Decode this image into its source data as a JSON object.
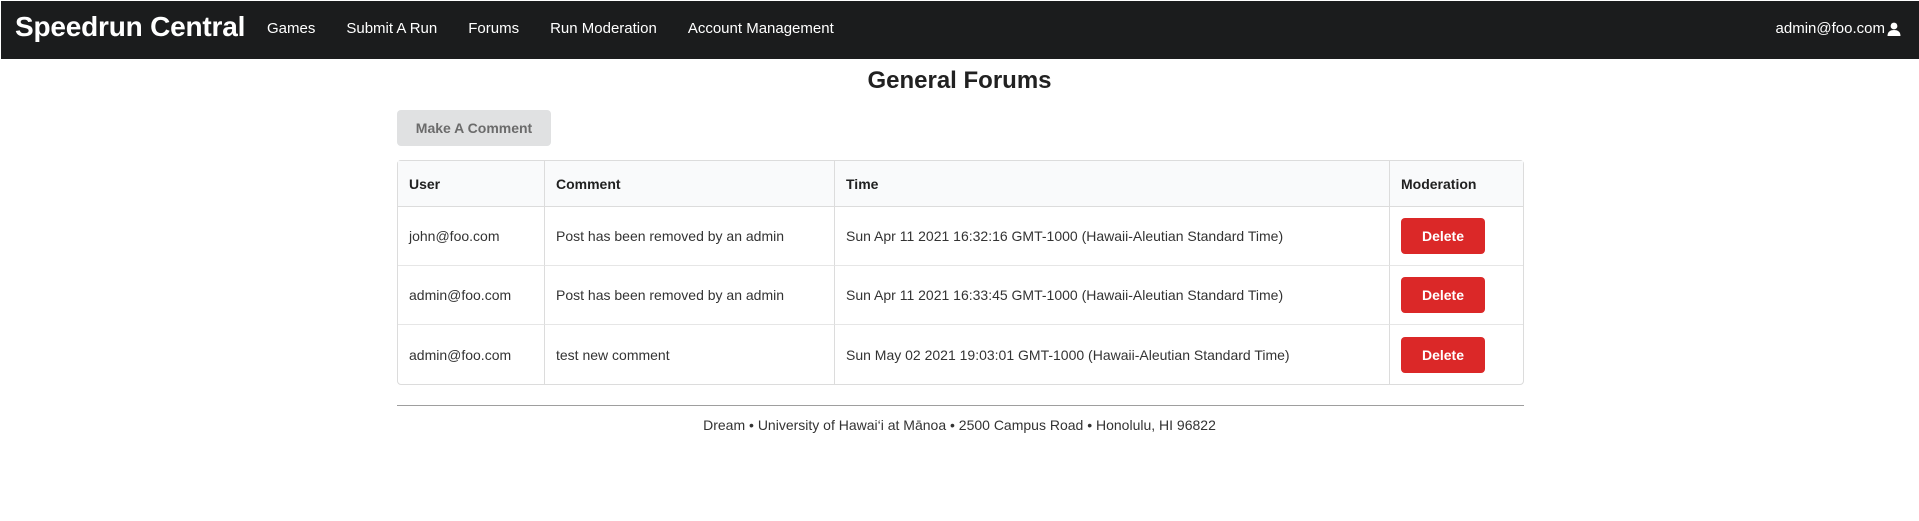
{
  "navbar": {
    "brand": "Speedrun Central",
    "items": [
      {
        "label": "Games"
      },
      {
        "label": "Submit A Run"
      },
      {
        "label": "Forums"
      },
      {
        "label": "Run Moderation"
      },
      {
        "label": "Account Management"
      }
    ],
    "user": "admin@foo.com",
    "user_icon": "user-icon"
  },
  "page": {
    "title": "General Forums",
    "comment_button": "Make A Comment"
  },
  "table": {
    "headers": [
      "User",
      "Comment",
      "Time",
      "Moderation"
    ],
    "rows": [
      {
        "user": "john@foo.com",
        "comment": "Post has been removed by an admin",
        "time": "Sun Apr 11 2021 16:32:16 GMT-1000 (Hawaii-Aleutian Standard Time)",
        "action": "Delete"
      },
      {
        "user": "admin@foo.com",
        "comment": "Post has been removed by an admin",
        "time": "Sun Apr 11 2021 16:33:45 GMT-1000 (Hawaii-Aleutian Standard Time)",
        "action": "Delete"
      },
      {
        "user": "admin@foo.com",
        "comment": "test new comment",
        "time": "Sun May 02 2021 19:03:01 GMT-1000 (Hawaii-Aleutian Standard Time)",
        "action": "Delete"
      }
    ]
  },
  "footer": {
    "text": "Dream • University of Hawai‘i at Mānoa • 2500 Campus Road • Honolulu, HI 96822"
  },
  "colors": {
    "navbar_bg": "#1b1c1d",
    "delete_red": "#db2828",
    "secondary_button": "#e0e1e2"
  }
}
